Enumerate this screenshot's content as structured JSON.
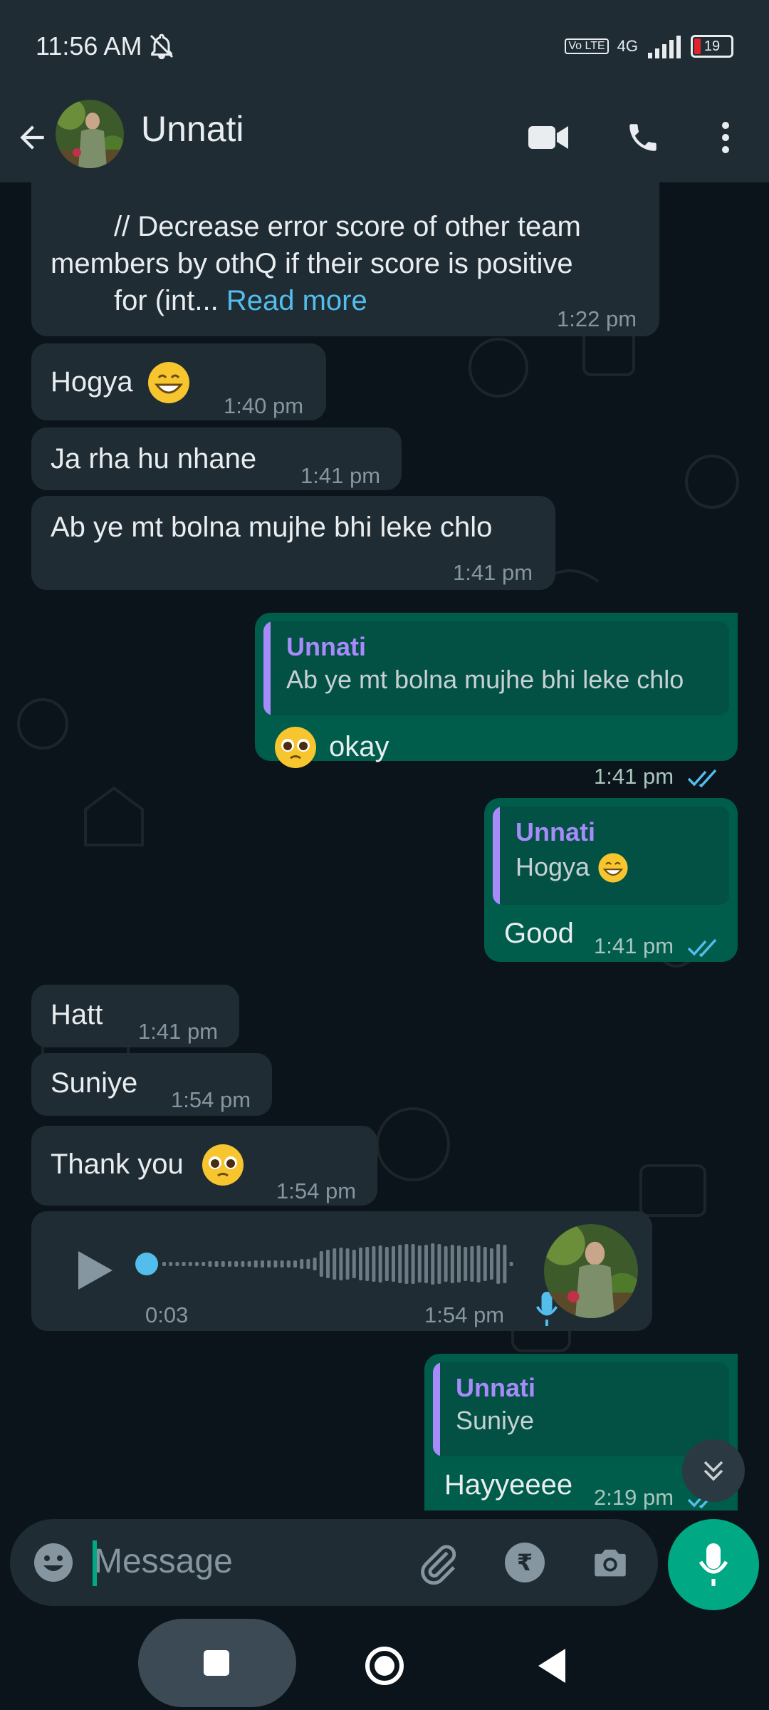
{
  "status_bar": {
    "time": "11:56 AM",
    "network": "4G",
    "volte": "Vo LTE",
    "battery": "19"
  },
  "header": {
    "contact_name": "Unnati"
  },
  "messages": {
    "m1": {
      "text_line1": "// Decrease error score of other team",
      "text_line2": "members by othQ if their score is positive",
      "text_line3": "for (int...",
      "read_more": "Read more",
      "time": "1:22 pm"
    },
    "m2": {
      "text": "Hogya",
      "time": "1:40 pm"
    },
    "m3": {
      "text": "Ja rha hu nhane",
      "time": "1:41 pm"
    },
    "m4": {
      "text": "Ab ye mt bolna mujhe bhi leke chlo",
      "time": "1:41 pm"
    },
    "m5": {
      "quote_name": "Unnati",
      "quote_text": "Ab ye mt bolna mujhe bhi leke chlo",
      "text": "okay",
      "time": "1:41 pm"
    },
    "m6": {
      "quote_name": "Unnati",
      "quote_text": "Hogya",
      "text": "Good",
      "time": "1:41 pm"
    },
    "m7": {
      "text": "Hatt",
      "time": "1:41 pm"
    },
    "m8": {
      "text": "Suniye",
      "time": "1:54 pm"
    },
    "m9": {
      "text": "Thank you",
      "time": "1:54 pm"
    },
    "m10": {
      "duration": "0:03",
      "time": "1:54 pm"
    },
    "m11": {
      "quote_name": "Unnati",
      "quote_text": "Suniye",
      "text": "Hayyeeee",
      "time": "2:19 pm"
    }
  },
  "composer": {
    "placeholder": "Message"
  },
  "colors": {
    "accent": "#00a884",
    "incoming_bubble": "#1f2c34",
    "outgoing_bubble": "#005c4b",
    "quote_name": "#a78bfa",
    "link": "#53bdeb"
  },
  "icons": [
    "back-arrow-icon",
    "video-call-icon",
    "phone-icon",
    "more-vert-icon",
    "emoji-icon",
    "attach-icon",
    "rupee-icon",
    "camera-icon",
    "mic-icon",
    "play-icon",
    "scroll-down-icon",
    "nav-square-icon",
    "nav-home-icon",
    "nav-back-icon"
  ]
}
